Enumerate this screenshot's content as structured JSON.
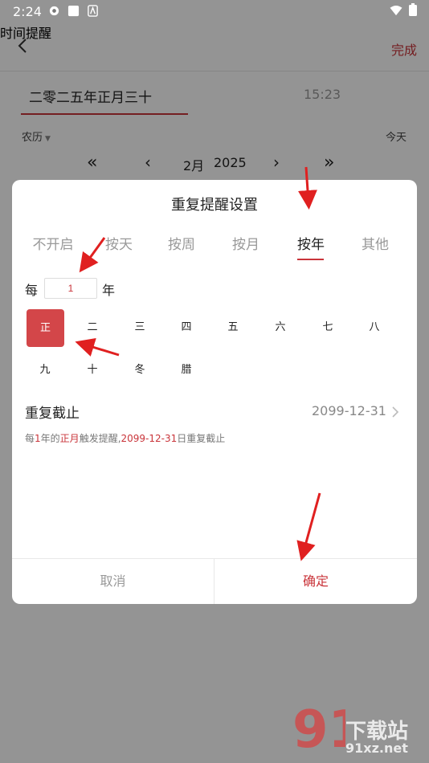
{
  "status_bar": {
    "time": "2:24"
  },
  "header": {
    "title": "时间提醒",
    "done": "完成"
  },
  "date_tab": {
    "lunar_text": "二零二五年正月三十",
    "time_text": "15:23"
  },
  "calendar": {
    "lunar_label": "农历",
    "today": "今天",
    "month": "2月",
    "year": "2025"
  },
  "dialog": {
    "title": "重复提醒设置",
    "tabs": [
      "不开启",
      "按天",
      "按周",
      "按月",
      "按年",
      "其他"
    ],
    "active_tab": "按年",
    "every_prefix": "每",
    "every_value": "1",
    "every_suffix": "年",
    "months": [
      "正",
      "二",
      "三",
      "四",
      "五",
      "六",
      "七",
      "八",
      "九",
      "十",
      "冬",
      "腊"
    ],
    "selected_month": "正",
    "repeat_end_label": "重复截止",
    "repeat_end_date": "2099-12-31",
    "summary": {
      "p1": "每",
      "n": "1",
      "p2": "年的",
      "m": "正月",
      "p3": "触发提醒,",
      "d": "2099-12-31",
      "p4": "日重复截止"
    },
    "cancel": "取消",
    "ok": "确定"
  },
  "watermark": {
    "top": "下载站",
    "url": "91xz.net"
  },
  "colors": {
    "accent": "#c9343a",
    "selected_month_bg": "#d34649",
    "arrow": "#e02020"
  }
}
